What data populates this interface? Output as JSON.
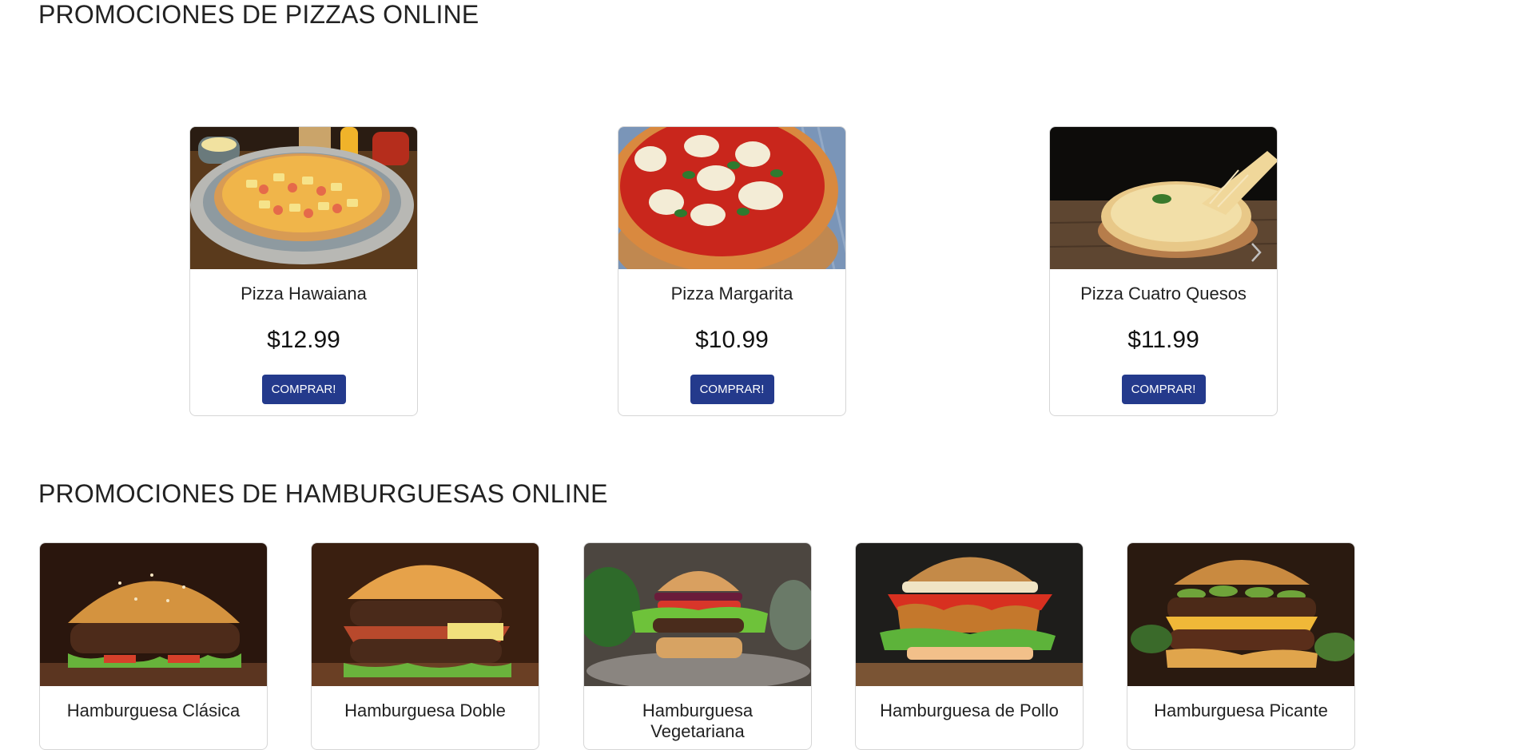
{
  "pizza_section": {
    "title": "PROMOCIONES DE PIZZAS ONLINE",
    "items": [
      {
        "name": "Pizza Hawaiana",
        "price": "$12.99",
        "button": "COMPRAR!"
      },
      {
        "name": "Pizza Margarita",
        "price": "$10.99",
        "button": "COMPRAR!"
      },
      {
        "name": "Pizza Cuatro Quesos",
        "price": "$11.99",
        "button": "COMPRAR!"
      }
    ]
  },
  "burger_section": {
    "title": "PROMOCIONES DE HAMBURGUESAS ONLINE",
    "items": [
      {
        "name": "Hamburguesa Clásica"
      },
      {
        "name": "Hamburguesa Doble"
      },
      {
        "name": "Hamburguesa Vegetariana"
      },
      {
        "name": "Hamburguesa de Pollo"
      },
      {
        "name": "Hamburguesa Picante"
      }
    ]
  },
  "icons": {
    "carousel_next": "chevron-right-icon"
  },
  "colors": {
    "button_bg": "#243a8c",
    "button_text": "#ffffff",
    "card_border": "#d6d6d6"
  }
}
